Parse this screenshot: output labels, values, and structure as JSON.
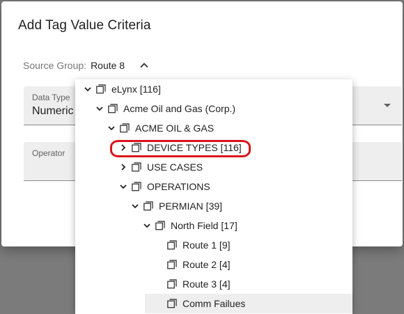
{
  "dialog": {
    "title": "Add Tag Value Criteria",
    "source_group_label": "Source Group:",
    "source_group_value": "Route 8",
    "data_type": {
      "label": "Data Type",
      "value": "Numeric"
    },
    "operator": {
      "label": "Operator",
      "value": ""
    }
  },
  "tree": {
    "items": [
      {
        "label": "eLynx [116]",
        "level": 0,
        "toggle": "expanded"
      },
      {
        "label": "Acme Oil and Gas (Corp.)",
        "level": 1,
        "toggle": "expanded"
      },
      {
        "label": "ACME OIL & GAS",
        "level": 2,
        "toggle": "expanded"
      },
      {
        "label": "DEVICE TYPES [116]",
        "level": 3,
        "toggle": "collapsed"
      },
      {
        "label": "USE CASES",
        "level": 3,
        "toggle": "collapsed"
      },
      {
        "label": "OPERATIONS",
        "level": 3,
        "toggle": "expanded"
      },
      {
        "label": "PERMIAN [39]",
        "level": 4,
        "toggle": "expanded"
      },
      {
        "label": "North Field [17]",
        "level": 5,
        "toggle": "expanded"
      },
      {
        "label": "Route 1 [9]",
        "level": 6,
        "toggle": "none"
      },
      {
        "label": "Route 2 [4]",
        "level": 6,
        "toggle": "none"
      },
      {
        "label": "Route 3 [4]",
        "level": 6,
        "toggle": "none"
      },
      {
        "label": "Comm Failues",
        "level": 6,
        "toggle": "none",
        "selected": true
      }
    ]
  },
  "colors": {
    "highlight": "#d9141c",
    "selected_row": "#eeeeee",
    "field_bg": "#eeeeee"
  },
  "icons": {
    "expanded": "chevron-down-icon",
    "collapsed": "chevron-right-icon",
    "node": "stacked-squares-icon"
  }
}
